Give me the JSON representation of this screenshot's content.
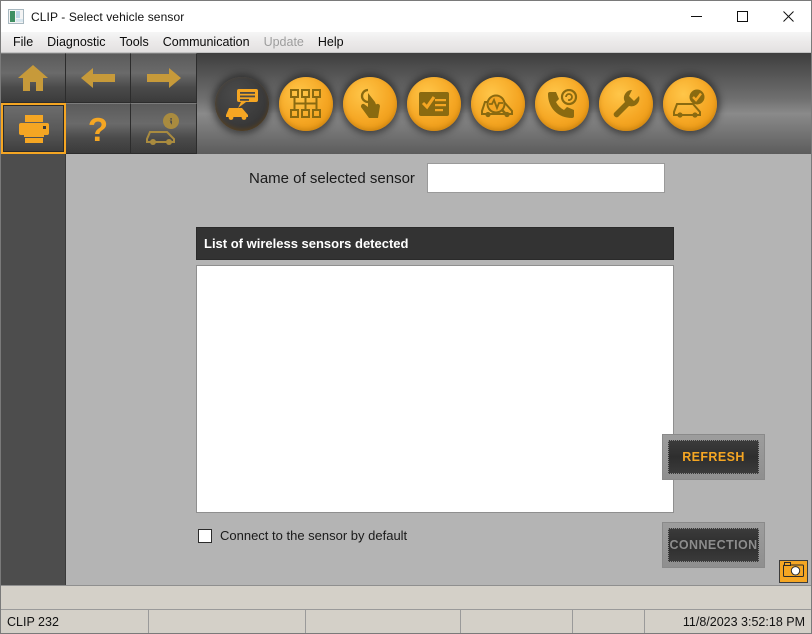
{
  "window": {
    "title": "CLIP - Select vehicle sensor",
    "icon": "app-icon",
    "minimize": "—",
    "maximize": "☐",
    "close": "✕"
  },
  "menu": {
    "items": [
      {
        "label": "File",
        "enabled": true
      },
      {
        "label": "Diagnostic",
        "enabled": true
      },
      {
        "label": "Tools",
        "enabled": true
      },
      {
        "label": "Communication",
        "enabled": true
      },
      {
        "label": "Update",
        "enabled": false
      },
      {
        "label": "Help",
        "enabled": true
      }
    ]
  },
  "toolbar": {
    "nav_buttons": [
      {
        "name": "home-icon",
        "label": "Home",
        "selected": false
      },
      {
        "name": "arrow-left-icon",
        "label": "Back",
        "selected": false
      },
      {
        "name": "arrow-right-icon",
        "label": "Forward",
        "selected": false
      },
      {
        "name": "printer-icon",
        "label": "Print",
        "selected": true
      },
      {
        "name": "question-mark-icon",
        "label": "Help",
        "selected": false
      },
      {
        "name": "car-info-icon",
        "label": "Vehicle information",
        "selected": false
      }
    ],
    "circle_buttons": [
      {
        "name": "car-identification-icon",
        "label": "Vehicle identification",
        "active": true
      },
      {
        "name": "ecu-network-icon",
        "label": "ECU network",
        "active": false
      },
      {
        "name": "touch-test-icon",
        "label": "Guided test",
        "active": false
      },
      {
        "name": "checklist-icon",
        "label": "Report",
        "active": false
      },
      {
        "name": "car-diagnostic-search-icon",
        "label": "Diagnostics",
        "active": false
      },
      {
        "name": "phone-support-icon",
        "label": "Technical support",
        "active": false
      },
      {
        "name": "wrench-icon",
        "label": "Tools",
        "active": false
      },
      {
        "name": "car-validated-icon",
        "label": "Vehicle check",
        "active": false
      }
    ]
  },
  "main": {
    "sensor_name_label": "Name of selected sensor",
    "sensor_name_value": "",
    "sensor_name_placeholder": "",
    "list_header": "List of wireless sensors detected",
    "list_items": [],
    "checkbox_label": "Connect to the sensor by default",
    "checkbox_checked": false,
    "refresh_button": "REFRESH",
    "refresh_enabled": true,
    "connection_button": "CONNECTION",
    "connection_enabled": false,
    "camera_icon": "camera-icon"
  },
  "statusbar": {
    "cells": [
      {
        "text": "CLIP 232",
        "align": "left",
        "width": 148
      },
      {
        "text": "",
        "align": "left",
        "width": 157
      },
      {
        "text": "",
        "align": "left",
        "width": 155
      },
      {
        "text": "",
        "align": "left",
        "width": 112
      },
      {
        "text": "",
        "align": "left",
        "width": 72
      },
      {
        "text": "11/8/2023 3:52:18 PM",
        "align": "right",
        "width": 168
      }
    ]
  },
  "colors": {
    "accent_orange": "#f5a623",
    "dark_panel": "#333333",
    "sidebar": "#4d4d4d",
    "window_bg": "#b4b4b4",
    "status_bg": "#d4d0c8"
  }
}
